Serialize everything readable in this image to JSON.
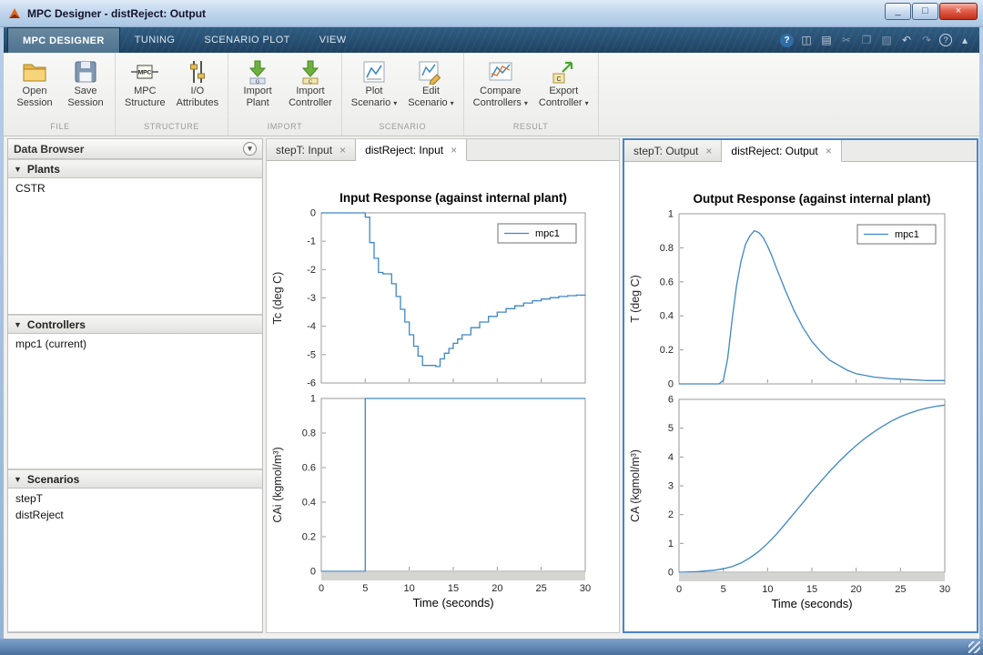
{
  "window": {
    "title": "MPC Designer - distReject: Output",
    "minimize": "_",
    "maximize": "□",
    "close": "×"
  },
  "ribbon": {
    "dropdown_glyph": "▾",
    "tabs": [
      {
        "label": "MPC DESIGNER"
      },
      {
        "label": "TUNING"
      },
      {
        "label": "SCENARIO PLOT"
      },
      {
        "label": "VIEW"
      }
    ],
    "active_tab": "MPC DESIGNER",
    "quick_icons": [
      {
        "name": "help-badge-icon",
        "glyph": "?"
      },
      {
        "name": "snapshot-icon",
        "glyph": "◫"
      },
      {
        "name": "save-icon",
        "glyph": "▤"
      },
      {
        "name": "cut-icon",
        "glyph": "✂"
      },
      {
        "name": "copy-icon",
        "glyph": "❐"
      },
      {
        "name": "paste-icon",
        "glyph": "▨"
      },
      {
        "name": "undo-icon",
        "glyph": "↶"
      },
      {
        "name": "redo-icon",
        "glyph": "↷"
      },
      {
        "name": "help-icon",
        "glyph": "?"
      },
      {
        "name": "collapse-ribbon-icon",
        "glyph": "▴"
      }
    ],
    "groups": [
      {
        "label": "FILE",
        "buttons": [
          {
            "line1": "Open",
            "line2": "Session",
            "icon": "folder-icon",
            "dropdown": false
          },
          {
            "line1": "Save",
            "line2": "Session",
            "icon": "floppy-icon",
            "dropdown": false
          }
        ]
      },
      {
        "label": "STRUCTURE",
        "buttons": [
          {
            "line1": "MPC",
            "line2": "Structure",
            "icon": "mpc-structure-icon",
            "dropdown": false
          },
          {
            "line1": "I/O",
            "line2": "Attributes",
            "icon": "io-attributes-icon",
            "dropdown": false
          }
        ]
      },
      {
        "label": "IMPORT",
        "buttons": [
          {
            "line1": "Import",
            "line2": "Plant",
            "icon": "import-plant-icon",
            "dropdown": false
          },
          {
            "line1": "Import",
            "line2": "Controller",
            "icon": "import-controller-icon",
            "dropdown": false
          }
        ]
      },
      {
        "label": "SCENARIO",
        "buttons": [
          {
            "line1": "Plot",
            "line2": "Scenario",
            "icon": "plot-scenario-icon",
            "dropdown": true
          },
          {
            "line1": "Edit",
            "line2": "Scenario",
            "icon": "edit-scenario-icon",
            "dropdown": true
          }
        ]
      },
      {
        "label": "RESULT",
        "buttons": [
          {
            "line1": "Compare",
            "line2": "Controllers",
            "icon": "compare-controllers-icon",
            "dropdown": true
          },
          {
            "line1": "Export",
            "line2": "Controller",
            "icon": "export-controller-icon",
            "dropdown": true
          }
        ]
      }
    ]
  },
  "data_browser": {
    "title": "Data Browser",
    "collapse_glyph": "▼",
    "menu_glyph": "▾",
    "sections": [
      {
        "label": "Plants",
        "items": [
          "CSTR"
        ]
      },
      {
        "label": "Controllers",
        "items": [
          "mpc1 (current)"
        ]
      },
      {
        "label": "Scenarios",
        "items": [
          "stepT",
          "distReject"
        ]
      }
    ]
  },
  "doc_panels": {
    "close_glyph": "×",
    "input": {
      "tabs": [
        {
          "label": "stepT: Input",
          "active": false
        },
        {
          "label": "distReject: Input",
          "active": true
        }
      ]
    },
    "output": {
      "tabs": [
        {
          "label": "stepT: Output",
          "active": false
        },
        {
          "label": "distReject: Output",
          "active": true
        }
      ]
    }
  },
  "colors": {
    "line": "#3e87c4",
    "focus": "#4a84c4"
  },
  "chart_data": [
    {
      "type": "line",
      "title": "Input Response (against internal plant)",
      "xlabel": "Time (seconds)",
      "xlim": [
        0,
        30
      ],
      "xticks": [
        0,
        5,
        10,
        15,
        20,
        25,
        30
      ],
      "legend": {
        "entries": [
          "mpc1"
        ],
        "position": "top-right"
      },
      "subplots": [
        {
          "ylabel": "Tc (deg C)",
          "ylim": [
            -6,
            0
          ],
          "yticks": [
            0,
            -1,
            -2,
            -3,
            -4,
            -5,
            -6
          ],
          "step": true,
          "show_legend": true,
          "x": [
            0,
            5,
            5.5,
            6,
            6.5,
            7,
            8,
            8.5,
            9,
            9.5,
            10,
            10.5,
            11,
            11.5,
            13,
            13.5,
            14,
            14.5,
            15,
            15.5,
            16,
            17,
            18,
            19,
            20,
            21,
            22,
            23,
            24,
            25,
            26,
            27,
            28,
            29,
            30
          ],
          "y": [
            0,
            -0.15,
            -1.05,
            -1.6,
            -2.1,
            -2.15,
            -2.5,
            -2.95,
            -3.4,
            -3.85,
            -4.3,
            -4.7,
            -5.05,
            -5.38,
            -5.42,
            -5.15,
            -4.95,
            -4.78,
            -4.6,
            -4.45,
            -4.3,
            -4.05,
            -3.85,
            -3.65,
            -3.5,
            -3.38,
            -3.28,
            -3.18,
            -3.1,
            -3.04,
            -2.99,
            -2.95,
            -2.92,
            -2.9,
            -2.88
          ]
        },
        {
          "ylabel": "CAi (kgmol/m³)",
          "ylim": [
            0,
            1
          ],
          "yticks": [
            0,
            0.2,
            0.4,
            0.6,
            0.8,
            1
          ],
          "step": true,
          "show_legend": false,
          "x": [
            0,
            5,
            30
          ],
          "y": [
            0,
            1,
            1
          ]
        }
      ]
    },
    {
      "type": "line",
      "title": "Output Response (against internal plant)",
      "xlabel": "Time (seconds)",
      "xlim": [
        0,
        30
      ],
      "xticks": [
        0,
        5,
        10,
        15,
        20,
        25,
        30
      ],
      "legend": {
        "entries": [
          "mpc1"
        ],
        "position": "top-right"
      },
      "subplots": [
        {
          "ylabel": "T (deg C)",
          "ylim": [
            0,
            1
          ],
          "yticks": [
            0,
            0.2,
            0.4,
            0.6,
            0.8,
            1
          ],
          "step": false,
          "show_legend": true,
          "x": [
            0,
            4.5,
            5,
            5.5,
            6,
            6.5,
            7,
            7.5,
            8,
            8.5,
            9,
            9.5,
            10,
            10.5,
            11,
            12,
            13,
            14,
            15,
            16,
            17,
            18,
            19,
            20,
            22,
            24,
            26,
            28,
            30
          ],
          "y": [
            0,
            0,
            0.02,
            0.15,
            0.38,
            0.58,
            0.72,
            0.82,
            0.87,
            0.9,
            0.89,
            0.86,
            0.81,
            0.75,
            0.68,
            0.55,
            0.43,
            0.33,
            0.25,
            0.19,
            0.14,
            0.11,
            0.08,
            0.06,
            0.04,
            0.03,
            0.025,
            0.02,
            0.02
          ]
        },
        {
          "ylabel": "CA (kgmol/m³)",
          "ylim": [
            0,
            6
          ],
          "yticks": [
            0,
            1,
            2,
            3,
            4,
            5,
            6
          ],
          "step": false,
          "show_legend": false,
          "x": [
            0,
            2,
            4,
            5,
            6,
            7,
            8,
            9,
            10,
            11,
            12,
            13,
            14,
            15,
            16,
            17,
            18,
            19,
            20,
            21,
            22,
            23,
            24,
            25,
            26,
            27,
            28,
            29,
            30
          ],
          "y": [
            0,
            0.02,
            0.07,
            0.12,
            0.2,
            0.32,
            0.5,
            0.72,
            1.0,
            1.32,
            1.68,
            2.05,
            2.42,
            2.8,
            3.15,
            3.5,
            3.82,
            4.12,
            4.4,
            4.65,
            4.87,
            5.07,
            5.25,
            5.4,
            5.52,
            5.62,
            5.7,
            5.76,
            5.8
          ]
        }
      ]
    }
  ]
}
